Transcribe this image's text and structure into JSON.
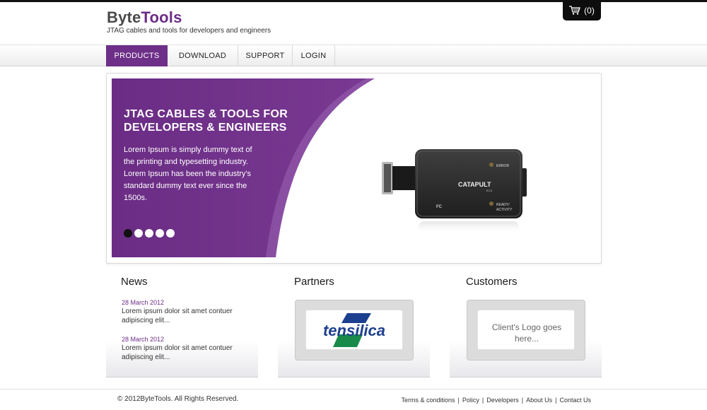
{
  "brand": {
    "name_part1": "Byte",
    "name_part2": "Tools",
    "tagline": "JTAG cables and tools for developers and engineers"
  },
  "cart": {
    "count_label": "(0)",
    "icon": "cart-icon"
  },
  "nav": {
    "items": [
      {
        "label": "PRODUCTS"
      },
      {
        "label": "DOWNLOAD"
      },
      {
        "label": "SUPPORT"
      },
      {
        "label": "LOGIN"
      }
    ]
  },
  "slider": {
    "title_line1": "JTAG CABLES & TOOLS FOR",
    "title_line2": "DEVELOPERS & ENGINEERS",
    "text_lines": [
      "Lorem Ipsum is simply dummy text of",
      "the printing and typesetting industry.",
      "Lorem Ipsum has been the industry's",
      "standard dummy text ever since the",
      "1500s."
    ],
    "device_name": "CATAPULT",
    "device_model": "EJ-2",
    "device_label_error": "ERROR",
    "device_label_ready1": "READY/",
    "device_label_ready2": "ACTIVITY",
    "device_mark": "FC",
    "accent_color": "#6e2f88"
  },
  "sections": {
    "news_title": "News",
    "partners_title": "Partners",
    "customers_title": "Customers"
  },
  "news": [
    {
      "date": "28 March 2012",
      "line1": "Lorem ipsum dolor sit amet contuer",
      "line2": "adipiscing elit..."
    },
    {
      "date": "28 March 2012",
      "line1": "Lorem ipsum dolor sit amet contuer",
      "line2": "adipiscing elit..."
    }
  ],
  "partners": {
    "logo_text": "tensilica"
  },
  "customers": {
    "placeholder_line1": "Client's Logo goes",
    "placeholder_line2": "here..."
  },
  "footer": {
    "copyright": "© 2012ByteTools. All Rights Reserved.",
    "links": [
      "Terms & conditions",
      "Policy",
      "Developers",
      "About Us",
      "Contact Us"
    ],
    "separator": "|"
  }
}
